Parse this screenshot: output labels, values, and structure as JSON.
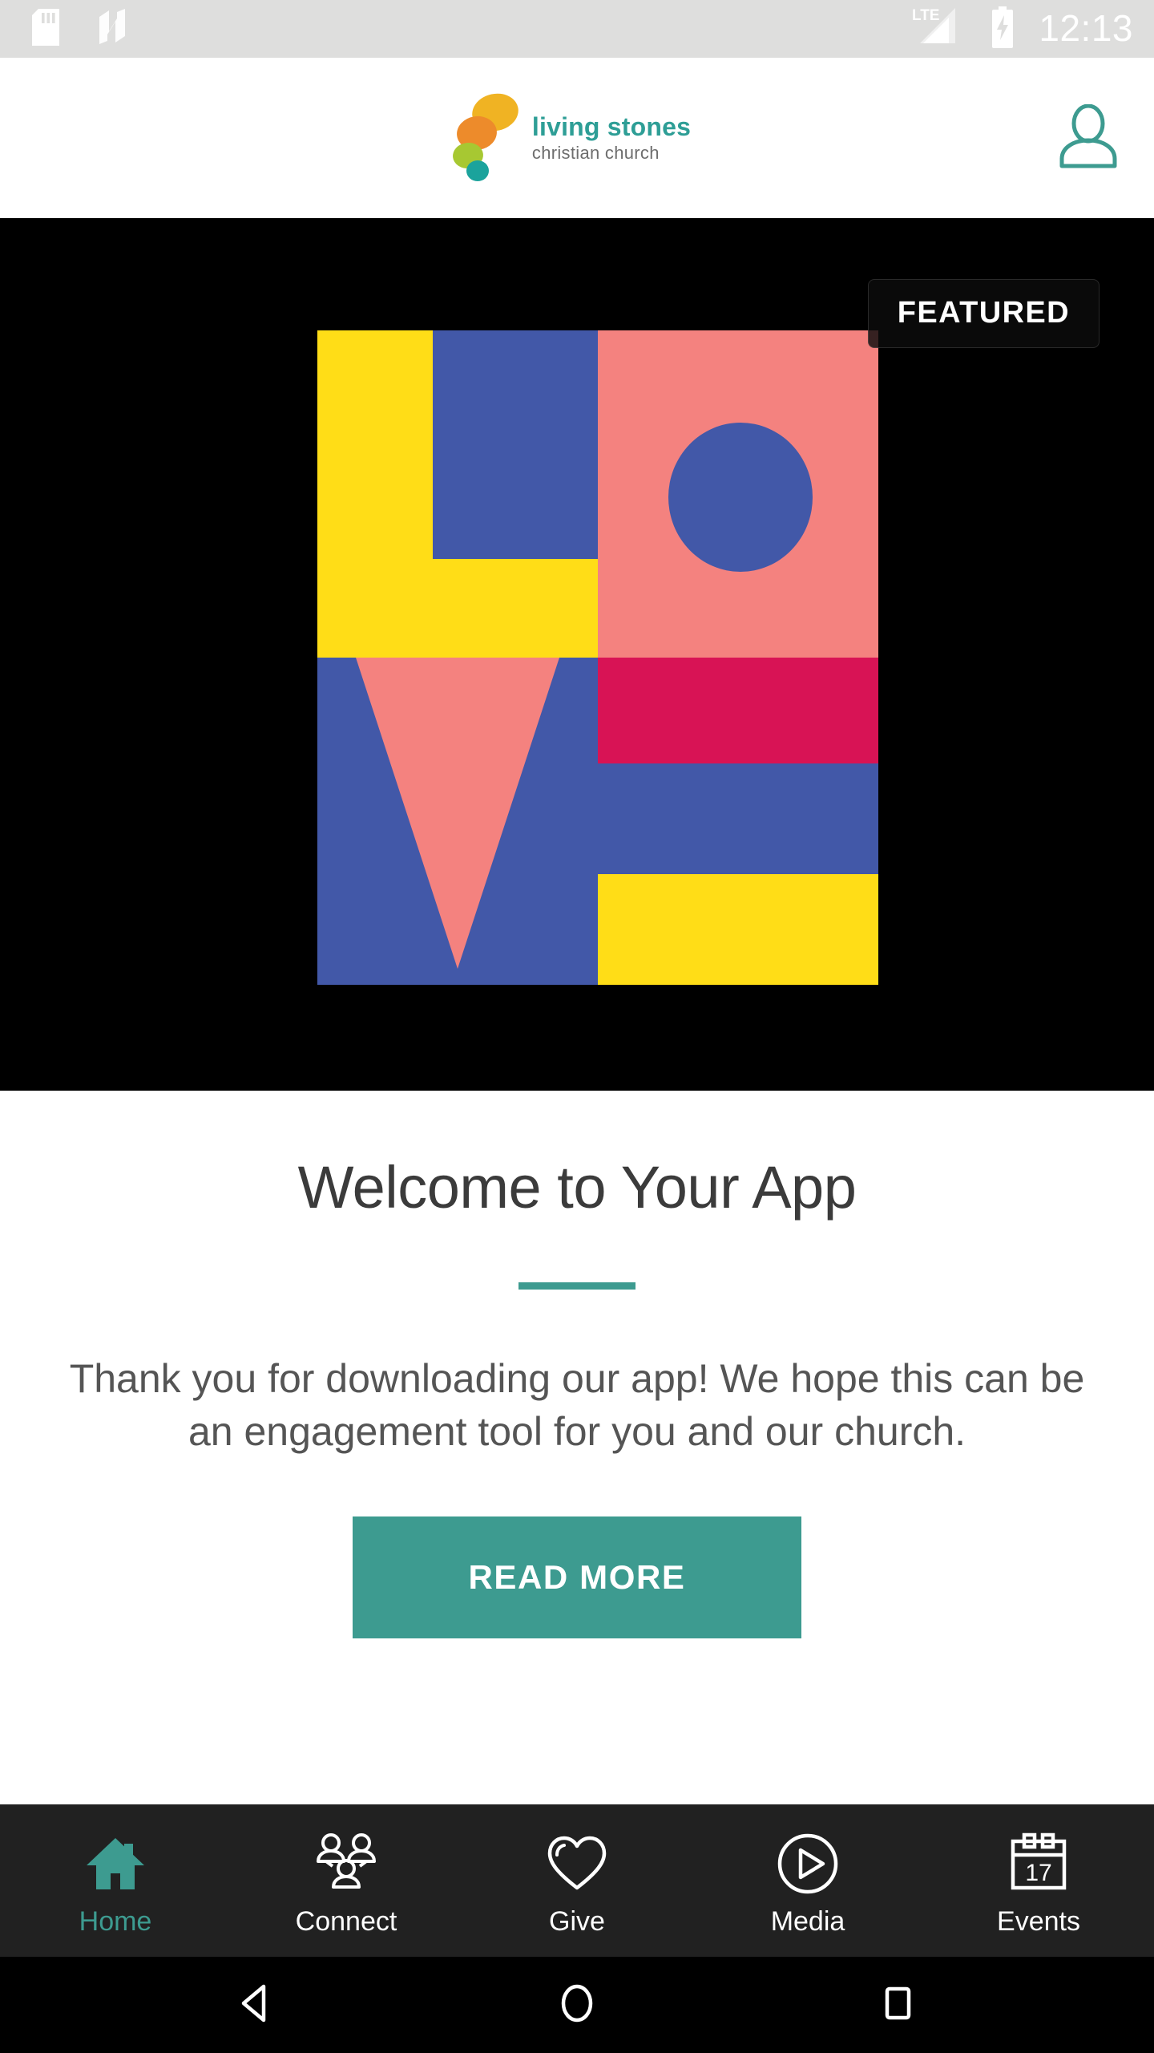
{
  "status_bar": {
    "icons": [
      "sd-card-icon",
      "android-nougat-icon",
      "lte-signal-icon",
      "battery-charging-icon"
    ],
    "network_label": "LTE",
    "time": "12:13",
    "background": "#dededd",
    "foreground": "#ffffff"
  },
  "header": {
    "brand_name": "living stones",
    "brand_subtitle": "christian church",
    "brand_color": "#2e9e96",
    "brand_sub_color": "#6e6e6e",
    "logo_stone_colors": [
      "#f0b323",
      "#ed8b2b",
      "#a7c832",
      "#1ba39c"
    ],
    "profile_icon": "person-icon",
    "profile_icon_color": "#3d9b90"
  },
  "hero": {
    "background": "#000000",
    "badge_label": "FEATURED",
    "artwork_name": "love-poster-artwork",
    "artwork_colors": {
      "yellow": "#ffdd17",
      "blue": "#4258a8",
      "pink": "#f4827f",
      "crimson": "#d81355"
    }
  },
  "main": {
    "title": "Welcome to Your App",
    "title_color": "#3b3b3b",
    "divider_color": "#3d9b90",
    "body": "Thank you for downloading our app! We hope this can be an engagement tool for you and our church.",
    "body_color": "#555555",
    "cta_label": "READ MORE",
    "cta_background": "#3d9b90",
    "cta_text_color": "#ffffff"
  },
  "tab_bar": {
    "background": "#212121",
    "active_color": "#3d9b90",
    "inactive_color": "#ffffff",
    "items": [
      {
        "label": "Home",
        "icon": "home-icon",
        "active": true
      },
      {
        "label": "Connect",
        "icon": "people-group-icon",
        "active": false
      },
      {
        "label": "Give",
        "icon": "heart-icon",
        "active": false
      },
      {
        "label": "Media",
        "icon": "play-circle-icon",
        "active": false
      },
      {
        "label": "Events",
        "icon": "calendar-icon",
        "active": false,
        "calendar_day": "17"
      }
    ]
  },
  "nav_bar": {
    "background": "#000000",
    "buttons": [
      {
        "name": "back-icon"
      },
      {
        "name": "home-circle-icon"
      },
      {
        "name": "recents-square-icon"
      }
    ]
  }
}
